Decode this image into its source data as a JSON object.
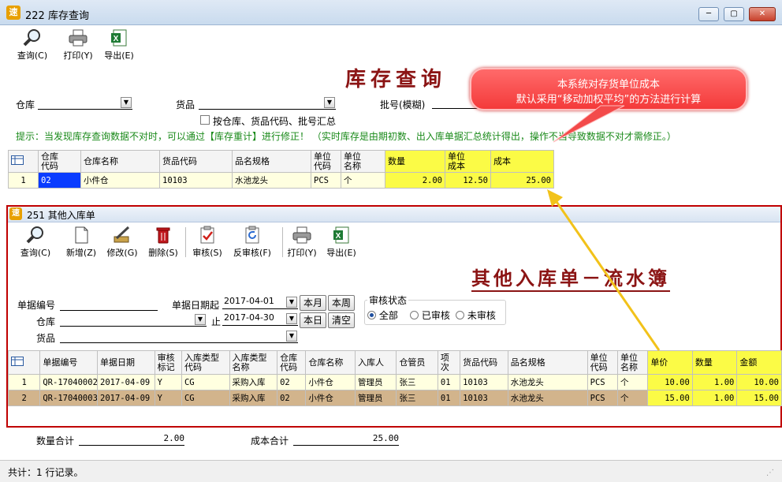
{
  "outer": {
    "logo": "速",
    "title": "222 库存查询",
    "toolbar": [
      {
        "label": "查询(C)",
        "icon": "magnifier-icon"
      },
      {
        "label": "打印(Y)",
        "icon": "printer-icon"
      },
      {
        "label": "导出(E)",
        "icon": "excel-icon"
      }
    ],
    "heading": "库存查询",
    "form": {
      "warehouse_label": "仓库",
      "goods_label": "货品",
      "batch_label": "批号(模糊)",
      "group_checkbox_label": "按仓库、货品代码、批号汇总",
      "hint": "提示：当发现库存查询数据不对时，可以通过【库存重计】进行修正！   （实时库存是由期初数、出入库单据汇总统计得出，操作不当导致数据不对才需修正。）"
    },
    "grid": {
      "headers": [
        "仓库\n代码",
        "仓库名称",
        "货品代码",
        "品名规格",
        "单位\n代码",
        "单位\n名称",
        "数量",
        "单位\n成本",
        "成本"
      ],
      "rows": [
        {
          "no": "1",
          "cells": [
            "02",
            "小件仓",
            "10103",
            "水池龙头",
            "PCS",
            "个",
            "2.00",
            "12.50",
            "25.00"
          ]
        }
      ]
    },
    "summary": {
      "qty_label": "数量合计",
      "qty_value": "2.00",
      "cost_label": "成本合计",
      "cost_value": "25.00"
    },
    "status": "共计：1 行记录。"
  },
  "bubble": {
    "line1": "本系统对存货单位成本",
    "line2": "默认采用“移动加权平均”的方法进行计算"
  },
  "inner": {
    "logo": "速",
    "title": "251 其他入库单",
    "toolbar": [
      {
        "label": "查询(C)",
        "icon": "magnifier-icon"
      },
      {
        "label": "新增(Z)",
        "icon": "new-document-icon"
      },
      {
        "label": "修改(G)",
        "icon": "edit-icon"
      },
      {
        "label": "删除(S)",
        "icon": "trash-icon"
      },
      {
        "label": "审核(S)",
        "icon": "approve-icon"
      },
      {
        "label": "反审核(F)",
        "icon": "unapprove-icon"
      },
      {
        "label": "打印(Y)",
        "icon": "printer-icon"
      },
      {
        "label": "导出(E)",
        "icon": "excel-icon"
      }
    ],
    "heading": "其他入库单－流水簿",
    "form": {
      "docno_label": "单据编号",
      "date_from_label": "单据日期起",
      "date_from": "2017-04-01",
      "date_to_label": "止",
      "date_to": "2017-04-30",
      "warehouse_label": "仓库",
      "goods_label": "货品",
      "btn_month": "本月",
      "btn_week": "本周",
      "btn_day": "本日",
      "btn_clear": "清空",
      "audit_label": "审核状态",
      "audit_options": [
        "全部",
        "已审核",
        "未审核"
      ],
      "audit_selected": "全部"
    },
    "grid": {
      "headers": [
        "单据编号",
        "单据日期",
        "审核\n标记",
        "入库类型\n代码",
        "入库类型\n名称",
        "仓库\n代码",
        "仓库名称",
        "入库人",
        "仓管员",
        "项\n次",
        "货品代码",
        "品名规格",
        "单位\n代码",
        "单位\n名称",
        "单价",
        "数量",
        "金额"
      ],
      "rows": [
        {
          "no": "1",
          "cells": [
            "QR-17040002",
            "2017-04-09",
            "Y",
            "CG",
            "采购入库",
            "02",
            "小件仓",
            "管理员",
            "张三",
            "01",
            "10103",
            "水池龙头",
            "PCS",
            "个",
            "10.00",
            "1.00",
            "10.00"
          ]
        },
        {
          "no": "2",
          "cells": [
            "QR-17040003",
            "2017-04-09",
            "Y",
            "CG",
            "采购入库",
            "02",
            "小件仓",
            "管理员",
            "张三",
            "01",
            "10103",
            "水池龙头",
            "PCS",
            "个",
            "15.00",
            "1.00",
            "15.00"
          ]
        }
      ]
    }
  },
  "colors": {
    "title_red": "#8b1414",
    "highlight_yellow": "#fbfb46",
    "hint_green": "#1a8a1a",
    "inner_border": "#c00000",
    "selected_row": "#d2b48c"
  }
}
